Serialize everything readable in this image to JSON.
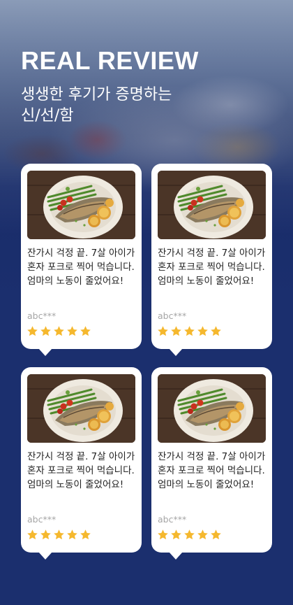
{
  "hero": {
    "title": "REAL REVIEW",
    "subtitle_line1": "생생한 후기가 증명하는",
    "subtitle_line2": "신/선/함"
  },
  "reviews": [
    {
      "text": "잔가시 걱정 끝. 7살 아이가 혼자 포크로 찍어 먹습니다. 엄마의 노동이 줄었어요!",
      "user": "abc***",
      "rating": 5
    },
    {
      "text": "잔가시 걱정 끝. 7살 아이가 혼자 포크로 찍어 먹습니다. 엄마의 노동이 줄었어요!",
      "user": "abc***",
      "rating": 5
    },
    {
      "text": "잔가시 걱정 끝. 7살 아이가 혼자 포크로 찍어 먹습니다. 엄마의 노동이 줄었어요!",
      "user": "abc***",
      "rating": 5
    },
    {
      "text": "잔가시 걱정 끝. 7살 아이가 혼자 포크로 찍어 먹습니다. 엄마의 노동이 줄었어요!",
      "user": "abc***",
      "rating": 5
    }
  ],
  "colors": {
    "background": "#1b2f6e",
    "star": "#f5b82e",
    "card": "#ffffff"
  },
  "icons": {
    "rating": "star-icon",
    "photo": "grilled-mackerel-photo"
  }
}
